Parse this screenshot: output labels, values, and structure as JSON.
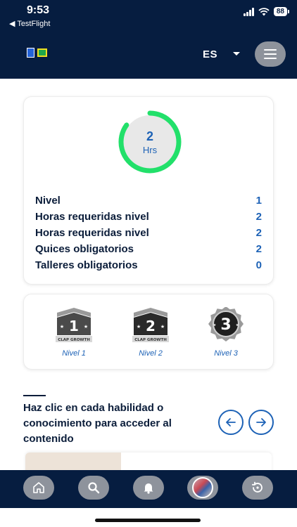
{
  "status_bar": {
    "time": "9:53",
    "back_app": "◀ TestFlight",
    "battery": "88"
  },
  "header": {
    "language": "ES"
  },
  "progress": {
    "value": "2",
    "unit": "Hrs",
    "ring_fraction": 0.85,
    "ring_color": "#22e06a",
    "stats": [
      {
        "label": "Nivel",
        "value": "1"
      },
      {
        "label": "Horas requeridas nivel",
        "value": "2"
      },
      {
        "label": "Horas requeridas nivel",
        "value": "2"
      },
      {
        "label": "Quices obligatorios",
        "value": "2"
      },
      {
        "label": "Talleres obligatorios",
        "value": "0"
      }
    ]
  },
  "levels": [
    {
      "label": "Nivel 1",
      "number": "1",
      "caption": "CLAP GROWTH"
    },
    {
      "label": "Nivel 2",
      "number": "2",
      "caption": "CLAP GROWTH"
    },
    {
      "label": "Nivel 3",
      "number": "3"
    }
  ],
  "intro": {
    "text": "Haz clic en cada habilidad o conocimiento para acceder al contenido"
  },
  "nav": {
    "items": [
      "home-icon",
      "search-icon",
      "bell-icon",
      "avatar",
      "history-icon"
    ]
  },
  "colors": {
    "navy": "#061d40",
    "accent_blue": "#1d62b6",
    "green": "#22e06a"
  }
}
